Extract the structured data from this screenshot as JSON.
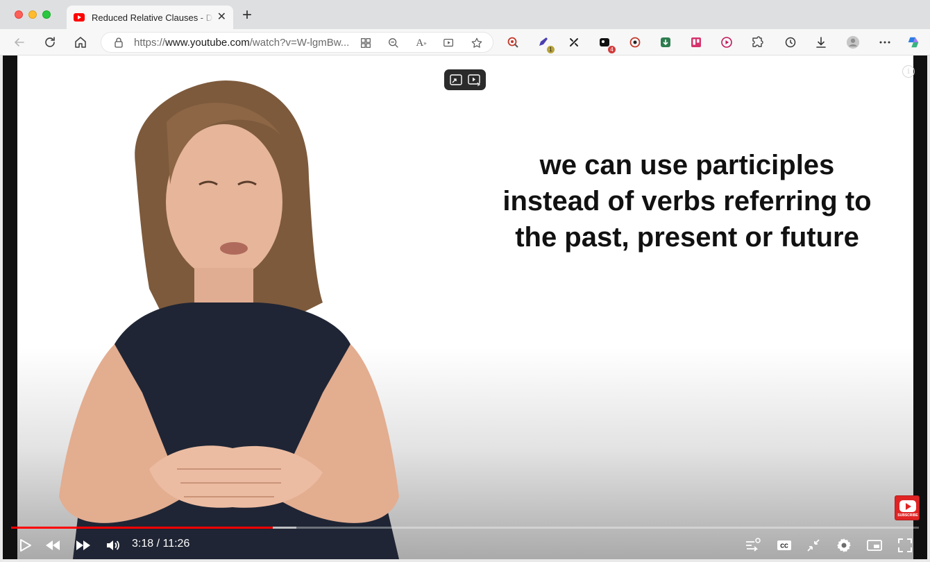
{
  "browser": {
    "tab": {
      "title": "Reduced Relative Clauses - De",
      "favicon": "youtube-icon"
    },
    "address": {
      "url_prefix": "https://",
      "url_host": "www.youtube.com",
      "url_path": "/watch?v=W-lgmBw..."
    },
    "extension_badges": {
      "ext2": "1",
      "ext4": "4"
    }
  },
  "video": {
    "slide_lines": [
      "we can use participles",
      "instead of verbs referring to",
      "the past, present or future"
    ],
    "current_time": "3:18",
    "duration": "11:26",
    "time_separator": " / ",
    "played_fraction": 0.288,
    "buffered_fraction": 0.314,
    "subscribe_watermark": "SUBSCRIBE",
    "info_glyph": "i"
  },
  "colors": {
    "progress": "#ff0000",
    "accent_youtube": "#ff0000"
  }
}
